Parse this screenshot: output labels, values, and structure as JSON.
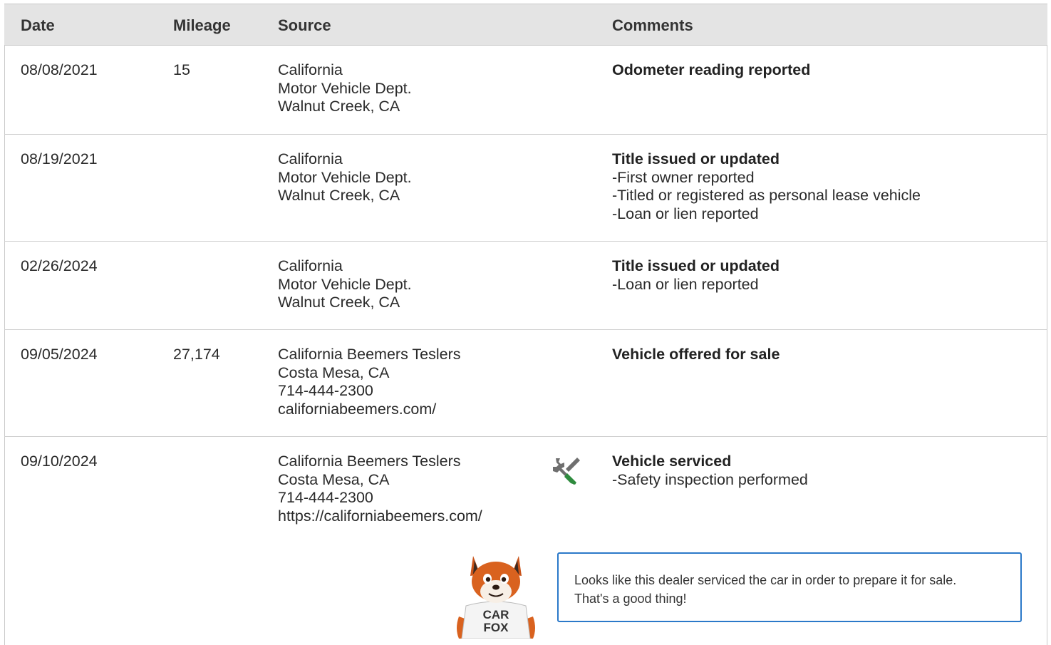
{
  "headers": {
    "date": "Date",
    "mileage": "Mileage",
    "source": "Source",
    "comments": "Comments"
  },
  "rows": [
    {
      "date": "08/08/2021",
      "mileage": "15",
      "source": [
        "California",
        "Motor Vehicle Dept.",
        "Walnut Creek, CA"
      ],
      "title": "Odometer reading reported",
      "details": []
    },
    {
      "date": "08/19/2021",
      "mileage": "",
      "source": [
        "California",
        "Motor Vehicle Dept.",
        "Walnut Creek, CA"
      ],
      "title": "Title issued or updated",
      "details": [
        "First owner reported",
        "Titled or registered as personal lease vehicle",
        "Loan or lien reported"
      ]
    },
    {
      "date": "02/26/2024",
      "mileage": "",
      "source": [
        "California",
        "Motor Vehicle Dept.",
        "Walnut Creek, CA"
      ],
      "title": "Title issued or updated",
      "details": [
        "Loan or lien reported"
      ]
    },
    {
      "date": "09/05/2024",
      "mileage": "27,174",
      "source": [
        "California Beemers Teslers",
        "Costa Mesa, CA",
        "714-444-2300",
        "californiabeemers.com/"
      ],
      "title": "Vehicle offered for sale",
      "details": []
    },
    {
      "date": "09/10/2024",
      "mileage": "",
      "source": [
        "California Beemers Teslers",
        "Costa Mesa, CA",
        "714-444-2300",
        "https://californiabeemers.com/"
      ],
      "title": "Vehicle serviced",
      "details": [
        "Safety inspection performed"
      ],
      "icon": "wrench-screwdriver-icon"
    }
  ],
  "tip": {
    "lines": [
      "Looks like this dealer serviced the car in order to prepare it for sale.",
      "That's a good thing!"
    ]
  },
  "mascot": {
    "shirt_line1": "CAR",
    "shirt_line2": "FOX"
  },
  "colors": {
    "header_bg": "#e4e4e4",
    "tip_border": "#2b79c9",
    "wrench_green": "#2e8b3e",
    "fox_orange": "#d9621f"
  }
}
